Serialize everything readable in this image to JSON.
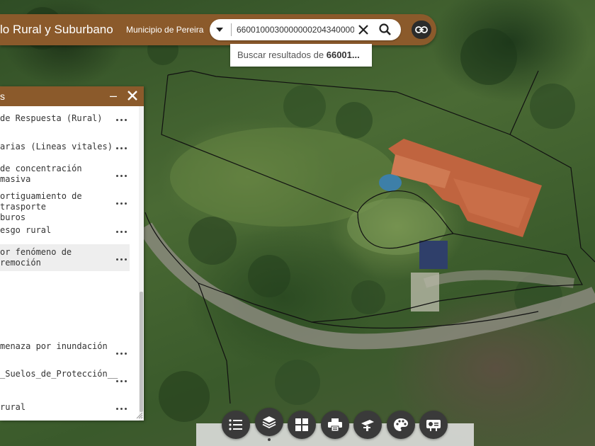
{
  "header": {
    "app_title": "lo Rural y Suburbano",
    "municipio": "Municipio de Pereira",
    "search_value": "6600100030000000204340000",
    "suggestion_prefix": "Buscar resultados de ",
    "suggestion_query": "66001..."
  },
  "panel": {
    "title": "s",
    "minimize": "–",
    "layers": [
      {
        "label": " de Respuesta (Rural)"
      },
      {
        "label": "arias (Lineas vitales)"
      },
      {
        "label": " de concentración masiva"
      },
      {
        "label": "ortiguamiento de trasporte\nburos"
      },
      {
        "label": "esgo rural"
      },
      {
        "label": "or fenómeno de remoción"
      },
      {
        "label": "menaza por inundación"
      },
      {
        "label": "_Suelos_de_Protección__"
      },
      {
        "label": " rural"
      }
    ]
  },
  "toolbar": {
    "tools": [
      {
        "name": "list-tool",
        "icon": "list-icon"
      },
      {
        "name": "layers-tool",
        "icon": "layers-icon"
      },
      {
        "name": "basemap-tool",
        "icon": "grid-icon"
      },
      {
        "name": "print-tool",
        "icon": "printer-icon"
      },
      {
        "name": "measure-tool",
        "icon": "measure-icon"
      },
      {
        "name": "symbology-tool",
        "icon": "palette-icon"
      },
      {
        "name": "legend-tool",
        "icon": "legend-icon"
      }
    ]
  },
  "colors": {
    "header": "#8b5a2b",
    "tool_button": "#3a3a3a",
    "roof": "#c0643f"
  }
}
